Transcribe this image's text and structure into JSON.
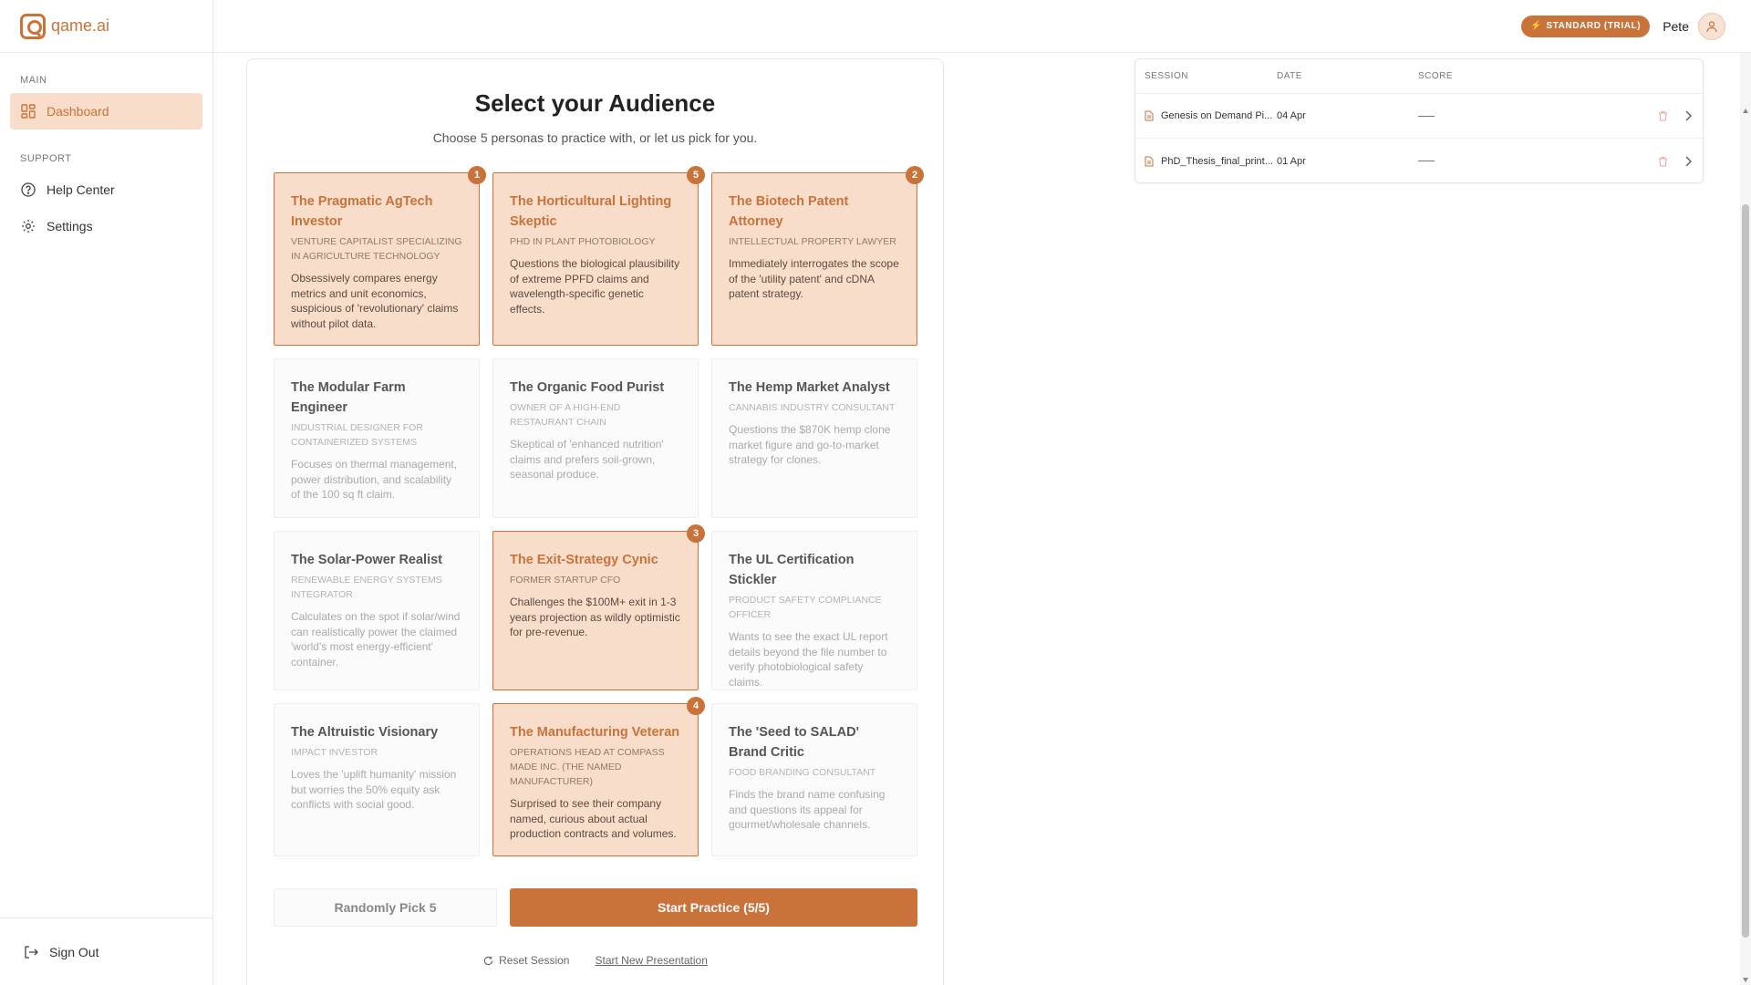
{
  "app": {
    "name": "qame.ai"
  },
  "sidebar": {
    "main_section": "MAIN",
    "support_section": "SUPPORT",
    "items": [
      {
        "label": "Dashboard",
        "icon": "dashboard-icon",
        "active": true
      },
      {
        "label": "Help Center",
        "icon": "help-icon"
      },
      {
        "label": "Settings",
        "icon": "gear-icon"
      }
    ],
    "sign_out": "Sign Out"
  },
  "header": {
    "plan_badge": "STANDARD (TRIAL)",
    "user_name": "Pete"
  },
  "main": {
    "title": "Select your Audience",
    "subtitle": "Choose 5 personas to practice with, or let us pick for you.",
    "personas": [
      {
        "name": "The Pragmatic AgTech Investor",
        "role": "VENTURE CAPITALIST SPECIALIZING IN AGRICULTURE TECHNOLOGY",
        "desc": "Obsessively compares energy metrics and unit economics, suspicious of 'revolutionary' claims without pilot data.",
        "selected": true,
        "order": "1"
      },
      {
        "name": "The Horticultural Lighting Skeptic",
        "role": "PHD IN PLANT PHOTOBIOLOGY",
        "desc": "Questions the biological plausibility of extreme PPFD claims and wavelength-specific genetic effects.",
        "selected": true,
        "order": "5"
      },
      {
        "name": "The Biotech Patent Attorney",
        "role": "INTELLECTUAL PROPERTY LAWYER",
        "desc": "Immediately interrogates the scope of the 'utility patent' and cDNA patent strategy.",
        "selected": true,
        "order": "2"
      },
      {
        "name": "The Modular Farm Engineer",
        "role": "INDUSTRIAL DESIGNER FOR CONTAINERIZED SYSTEMS",
        "desc": "Focuses on thermal management, power distribution, and scalability of the 100 sq ft claim.",
        "selected": false,
        "order": ""
      },
      {
        "name": "The Organic Food Purist",
        "role": "OWNER OF A HIGH-END RESTAURANT CHAIN",
        "desc": "Skeptical of 'enhanced nutrition' claims and prefers soil-grown, seasonal produce.",
        "selected": false,
        "order": ""
      },
      {
        "name": "The Hemp Market Analyst",
        "role": "CANNABIS INDUSTRY CONSULTANT",
        "desc": "Questions the $870K hemp clone market figure and go-to-market strategy for clones.",
        "selected": false,
        "order": ""
      },
      {
        "name": "The Solar-Power Realist",
        "role": "RENEWABLE ENERGY SYSTEMS INTEGRATOR",
        "desc": "Calculates on the spot if solar/wind can realistically power the claimed 'world's most energy-efficient' container.",
        "selected": false,
        "order": ""
      },
      {
        "name": "The Exit-Strategy Cynic",
        "role": "FORMER STARTUP CFO",
        "desc": "Challenges the $100M+ exit in 1-3 years projection as wildly optimistic for pre-revenue.",
        "selected": true,
        "order": "3"
      },
      {
        "name": "The UL Certification Stickler",
        "role": "PRODUCT SAFETY COMPLIANCE OFFICER",
        "desc": "Wants to see the exact UL report details beyond the file number to verify photobiological safety claims.",
        "selected": false,
        "order": ""
      },
      {
        "name": "The Altruistic Visionary",
        "role": "IMPACT INVESTOR",
        "desc": "Loves the 'uplift humanity' mission but worries the 50% equity ask conflicts with social good.",
        "selected": false,
        "order": ""
      },
      {
        "name": "The Manufacturing Veteran",
        "role": "OPERATIONS HEAD AT COMPASS MADE INC. (THE NAMED MANUFACTURER)",
        "desc": "Surprised to see their company named, curious about actual production contracts and volumes.",
        "selected": true,
        "order": "4"
      },
      {
        "name": "The 'Seed to SALAD' Brand Critic",
        "role": "FOOD BRANDING CONSULTANT",
        "desc": "Finds the brand name confusing and questions its appeal for gourmet/wholesale channels.",
        "selected": false,
        "order": ""
      }
    ],
    "random_button": "Randomly Pick 5",
    "start_button": "Start Practice (5/5)",
    "reset_link": "Reset Session",
    "new_presentation_link": "Start New Presentation"
  },
  "sessions": {
    "columns": [
      "SESSION",
      "DATE",
      "SCORE"
    ],
    "rows": [
      {
        "name": "Genesis on Demand Pi...",
        "date": "04 Apr",
        "score": ""
      },
      {
        "name": "PhD_Thesis_final_print...",
        "date": "01 Apr",
        "score": ""
      }
    ]
  },
  "colors": {
    "accent": "#c9733b",
    "selected_bg": "#f8ddcb",
    "card_bg": "#fbfbfb"
  }
}
